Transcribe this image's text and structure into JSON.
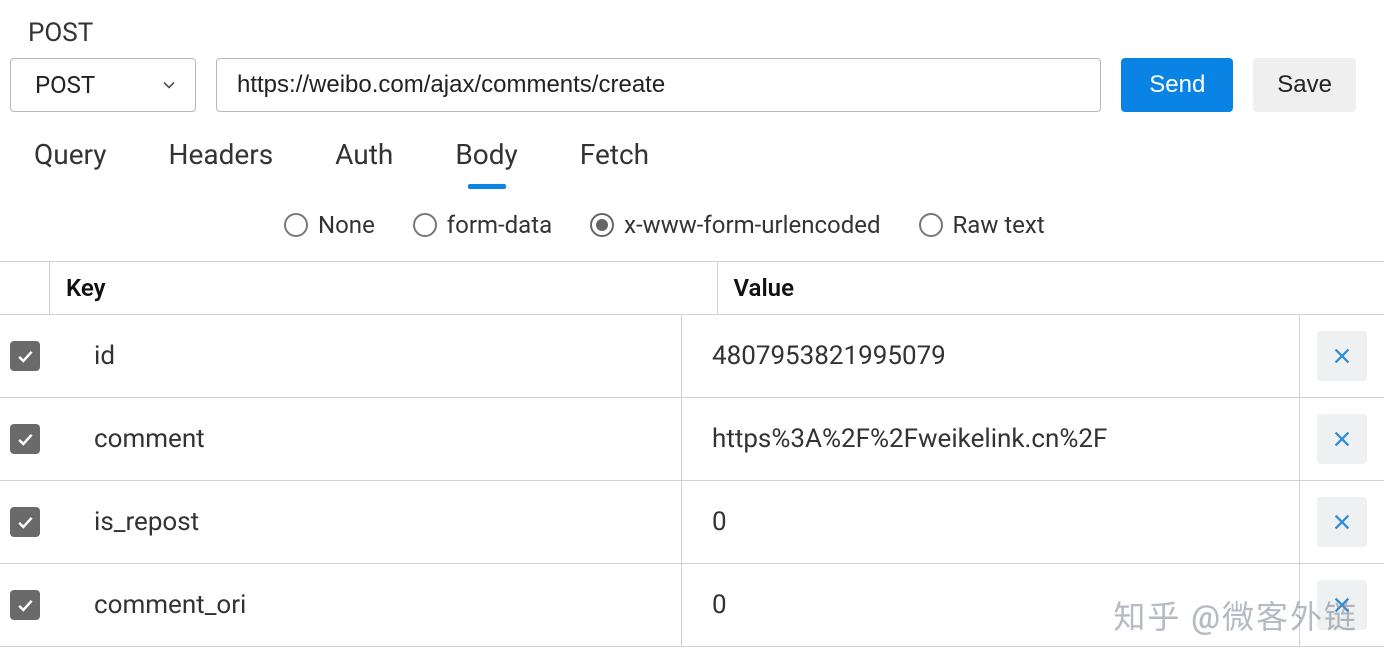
{
  "header": {
    "label": "POST"
  },
  "request": {
    "method": "POST",
    "url": "https://weibo.com/ajax/comments/create",
    "send_label": "Send",
    "save_label": "Save"
  },
  "tabs": {
    "query": "Query",
    "headers": "Headers",
    "auth": "Auth",
    "body": "Body",
    "fetch": "Fetch",
    "active": "body"
  },
  "body_types": {
    "none": "None",
    "formdata": "form-data",
    "urlencoded": "x-www-form-urlencoded",
    "rawtext": "Raw text",
    "selected": "urlencoded"
  },
  "table": {
    "key_header": "Key",
    "value_header": "Value",
    "rows": [
      {
        "key": "id",
        "value": "4807953821995079"
      },
      {
        "key": "comment",
        "value": "https%3A%2F%2Fweikelink.cn%2F"
      },
      {
        "key": "is_repost",
        "value": "0"
      },
      {
        "key": "comment_ori",
        "value": "0"
      }
    ]
  },
  "watermark": "知乎 @微客外链"
}
